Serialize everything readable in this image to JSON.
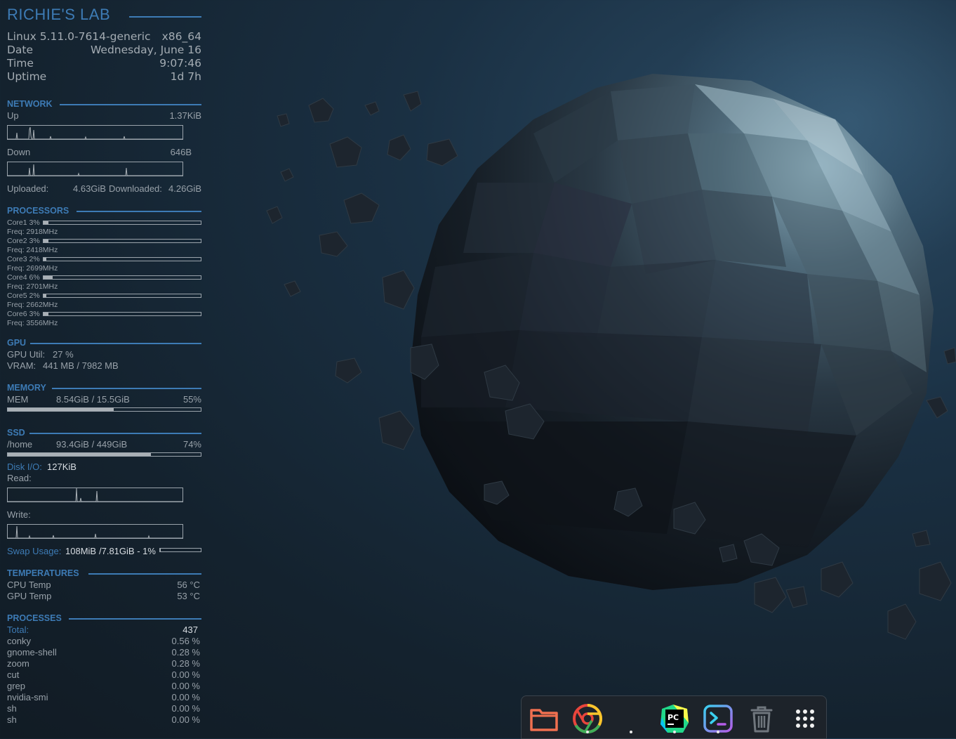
{
  "header": {
    "title": "RICHIE'S LAB"
  },
  "system": {
    "kernel": "Linux 5.11.0-7614-generic",
    "arch": "x86_64",
    "date_label": "Date",
    "date_value": "Wednesday, June 16",
    "time_label": "Time",
    "time_value": "9:07:46",
    "uptime_label": "Uptime",
    "uptime_value": "1d 7h"
  },
  "network": {
    "title": "NETWORK",
    "up_label": "Up",
    "up_value": "1.37KiB",
    "down_label": "Down",
    "down_value": "646B",
    "uploaded_label": "Uploaded:",
    "uploaded_value": "4.63GiB",
    "downloaded_label": "Downloaded:",
    "downloaded_value": "4.26GiB"
  },
  "processors": {
    "title": "PROCESSORS",
    "cores": [
      {
        "label": "Core1 3%",
        "usage": 3,
        "freq": "Freq: 2918MHz"
      },
      {
        "label": "Core2 3%",
        "usage": 3,
        "freq": "Freq: 2418MHz"
      },
      {
        "label": "Core3 2%",
        "usage": 2,
        "freq": "Freq: 2699MHz"
      },
      {
        "label": "Core4 6%",
        "usage": 6,
        "freq": "Freq: 2701MHz"
      },
      {
        "label": "Core5 2%",
        "usage": 2,
        "freq": "Freq: 2662MHz"
      },
      {
        "label": "Core6 3%",
        "usage": 3,
        "freq": "Freq: 3556MHz"
      }
    ]
  },
  "gpu": {
    "title": "GPU",
    "util_label": "GPU Util:",
    "util_value": "27 %",
    "vram_label": "VRAM:",
    "vram_value": "441 MB / 7982 MB"
  },
  "memory": {
    "title": "MEMORY",
    "label": "MEM",
    "value": "8.54GiB / 15.5GiB",
    "percent": "55%",
    "fraction": 0.55
  },
  "ssd": {
    "title": "SSD",
    "label": "/home",
    "value": "93.4GiB / 449GiB",
    "percent": "74%",
    "fraction": 0.74,
    "diskio_label": "Disk I/O:",
    "diskio_value": "127KiB",
    "read_label": "Read:",
    "write_label": "Write:",
    "swap_label": "Swap Usage:",
    "swap_value": "108MiB",
    "swap_total": "/7.81GiB - 1%",
    "swap_fraction": 0.01
  },
  "temperatures": {
    "title": "TEMPERATURES",
    "cpu_label": "CPU Temp",
    "cpu_value": "56 °C",
    "gpu_label": "GPU Temp",
    "gpu_value": "53 °C"
  },
  "processes": {
    "title": "PROCESSES",
    "total_label": "Total:",
    "total_value": "437",
    "list": [
      {
        "name": "conky",
        "cpu": "0.56 %"
      },
      {
        "name": "gnome-shell",
        "cpu": "0.28 %"
      },
      {
        "name": "zoom",
        "cpu": "0.28 %"
      },
      {
        "name": "cut",
        "cpu": "0.00 %"
      },
      {
        "name": "grep",
        "cpu": "0.00 %"
      },
      {
        "name": "nvidia-smi",
        "cpu": "0.00 %"
      },
      {
        "name": "sh",
        "cpu": "0.00 %"
      },
      {
        "name": "sh",
        "cpu": "0.00 %"
      }
    ]
  },
  "dock": {
    "items": [
      {
        "name": "files",
        "icon": "folder-icon",
        "running": false
      },
      {
        "name": "chrome",
        "icon": "chrome-icon",
        "running": true
      },
      {
        "name": "hidden-app",
        "icon": "",
        "running": true
      },
      {
        "name": "pycharm",
        "icon": "pycharm-icon",
        "running": true
      },
      {
        "name": "terminal",
        "icon": "terminal-icon",
        "running": true
      },
      {
        "name": "trash",
        "icon": "trash-icon",
        "running": false
      },
      {
        "name": "app-grid",
        "icon": "app-grid-icon",
        "running": false
      }
    ]
  }
}
